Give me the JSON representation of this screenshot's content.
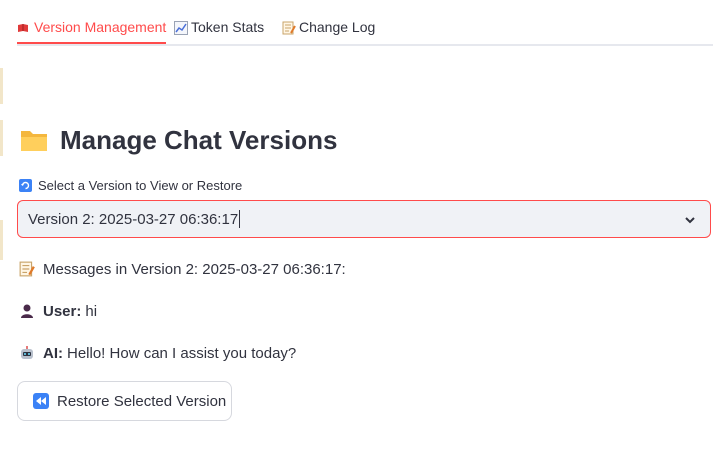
{
  "tabs": [
    {
      "label": "Version Management",
      "icon": "book-icon",
      "active": true
    },
    {
      "label": "Token Stats",
      "icon": "chart-icon",
      "active": false
    },
    {
      "label": "Change Log",
      "icon": "memo-icon",
      "active": false
    }
  ],
  "page": {
    "title": "Manage Chat Versions",
    "title_icon": "folder-icon"
  },
  "version_select": {
    "label": "Select a Version to View or Restore",
    "label_icon": "refresh-icon",
    "selected": "Version 2: 2025-03-27 06:36:17"
  },
  "messages": {
    "heading": "Messages in Version 2: 2025-03-27 06:36:17:",
    "items": [
      {
        "role": "User:",
        "text": "hi",
        "icon": "user-icon"
      },
      {
        "role": "AI:",
        "text": "Hello! How can I assist you today?",
        "icon": "robot-icon"
      }
    ]
  },
  "restore_button": {
    "label": "Restore Selected Version",
    "icon": "rewind-icon"
  },
  "colors": {
    "accent": "#ff4b4b",
    "text": "#31333f",
    "select_bg": "#f0f2f6"
  }
}
